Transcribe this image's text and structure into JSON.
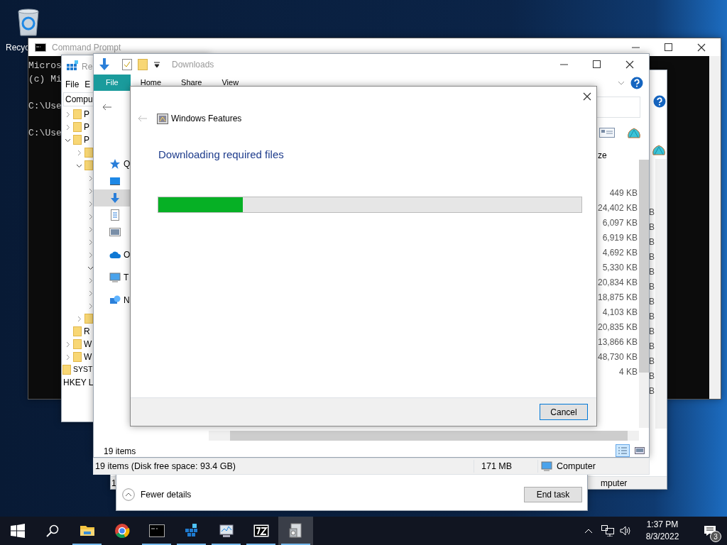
{
  "desktop": {
    "icons": [
      {
        "label": "Recyc"
      }
    ]
  },
  "command_prompt": {
    "title": "Command Prompt",
    "lines": [
      {
        "kind": "output",
        "text": "Micros"
      },
      {
        "kind": "output",
        "text": "(c) Mi"
      },
      {
        "kind": "prompt",
        "text": "C:\\Use"
      },
      {
        "kind": "prompt",
        "text": "C:\\Use"
      }
    ]
  },
  "background_window": {
    "size_fragments": [
      "B",
      "B",
      "B",
      "B",
      "B",
      "B",
      "B",
      "B",
      "B",
      "B",
      "B",
      "B",
      "B"
    ],
    "row_start": "1",
    "status": "mputer"
  },
  "task_manager": {
    "details_toggle": "Fewer details",
    "end_task": "End task"
  },
  "registry_editor": {
    "title": "Re",
    "menu": [
      "File",
      "E"
    ],
    "address": "Compu",
    "tree": [
      {
        "label": "P",
        "expanded": false
      },
      {
        "label": "P",
        "expanded": false
      },
      {
        "label": "P",
        "expanded": true,
        "children": [
          {
            "expanded": false
          },
          {
            "expanded": true,
            "children": [
              {
                "expanded": false
              },
              {
                "expanded": false
              },
              {
                "expanded": false
              },
              {
                "expanded": false
              },
              {
                "expanded": false
              },
              {
                "expanded": false
              },
              {
                "expanded": false
              },
              {
                "expanded": true
              },
              {
                "expanded": false
              },
              {
                "expanded": false
              },
              {
                "expanded": false
              }
            ]
          },
          {
            "expanded": false
          }
        ]
      },
      {
        "label": "R"
      },
      {
        "label": "W",
        "expanded": false
      },
      {
        "label": "W",
        "expanded": false
      }
    ],
    "tree_tail": [
      {
        "label": "SYST"
      }
    ],
    "status": "HKEY L"
  },
  "explorer": {
    "title": "Downloads",
    "ribbon_tabs": [
      {
        "label": "File",
        "selected": true
      },
      {
        "label": "Home",
        "selected": false
      },
      {
        "label": "Share",
        "selected": false
      },
      {
        "label": "View",
        "selected": false
      }
    ],
    "nav": [
      {
        "label": "Q",
        "kind": "star",
        "selected": false
      },
      {
        "kind": "desktop",
        "selected": false
      },
      {
        "kind": "download",
        "selected": true
      },
      {
        "kind": "document",
        "selected": false
      },
      {
        "kind": "picture",
        "selected": false
      },
      {
        "label": "O",
        "kind": "cloud",
        "selected": false
      },
      {
        "label": "T",
        "kind": "pc",
        "selected": false
      },
      {
        "label": "N",
        "kind": "network",
        "selected": false
      }
    ],
    "size_header": "ze",
    "sizes": [
      "449 KB",
      "24,402 KB",
      "6,097 KB",
      "6,919 KB",
      "4,692 KB",
      "5,330 KB",
      "20,834 KB",
      "18,875 KB",
      "4,103 KB",
      "20,835 KB",
      "13,866 KB",
      "48,730 KB",
      "4 KB"
    ],
    "status": "19 items",
    "view_buttons": [
      {
        "kind": "details",
        "selected": true
      },
      {
        "kind": "preview",
        "selected": false
      }
    ]
  },
  "file_manager_status": {
    "text": "19 items (Disk free space: 93.4 GB)",
    "size": "171 MB",
    "location": "Computer"
  },
  "dialog": {
    "title": "Windows Features",
    "heading": "Downloading required files",
    "progress": {
      "level": 0.2
    },
    "cancel": "Cancel"
  },
  "taskbar": {
    "apps": [
      {
        "kind": "explorer",
        "running": true,
        "active": false
      },
      {
        "kind": "chrome",
        "running": false,
        "active": false
      },
      {
        "kind": "cmd",
        "running": true,
        "active": false
      },
      {
        "kind": "registry",
        "running": true,
        "active": false
      },
      {
        "kind": "monitor",
        "running": true,
        "active": false
      },
      {
        "kind": "sevenzip",
        "running": true,
        "active": false
      },
      {
        "kind": "features",
        "running": true,
        "active": true
      }
    ],
    "time": "1:37 PM",
    "date": "8/3/2022",
    "notifications": "3"
  }
}
